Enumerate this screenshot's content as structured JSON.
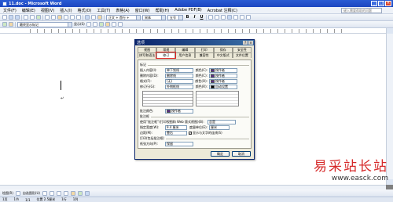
{
  "window": {
    "title": "11.doc - Microsoft Word"
  },
  "menu": {
    "items": [
      "文件(F)",
      "编辑(E)",
      "视图(V)",
      "插入(I)",
      "格式(O)",
      "工具(T)",
      "表格(A)",
      "窗口(W)",
      "帮助(H)",
      "Adobe PDF(B)",
      "Acrobat 注释(C)"
    ],
    "ask_placeholder": "键入需要帮助的问题"
  },
  "toolbar": {
    "style_value": "正文 + 首行 +",
    "font_value": "宋体",
    "size_value": "五号",
    "track_value": "最终显示标记",
    "show_label": "显示(S)"
  },
  "dialog": {
    "title": "选项",
    "tabs_row1": [
      "视图",
      "常规",
      "编辑",
      "打印",
      "保存",
      "安全性"
    ],
    "tabs_row2": [
      "拼写和语法",
      "修订",
      "用户信息",
      "兼容性",
      "中文版式",
      "文件位置"
    ],
    "group_markup": "标记",
    "rows": [
      {
        "label": "插入内容(I):",
        "value": "单下划线",
        "color_label": "颜色(C):",
        "color_value": "按作者",
        "swatch": "#5b2c8a"
      },
      {
        "label": "删除内容(D):",
        "value": "删除线",
        "color_label": "颜色(C):",
        "color_value": "按作者",
        "swatch": "#5b2c8a"
      },
      {
        "label": "格式(F):",
        "value": "(无)",
        "color_label": "颜色(O):",
        "color_value": "按作者",
        "swatch": "#5b2c8a"
      },
      {
        "label": "修订行(G):",
        "value": "外侧框线",
        "color_label": "颜色(R):",
        "color_value": "自动设置",
        "swatch": "#000000"
      }
    ],
    "comment_label": "批注颜色:",
    "comment_value": "按作者",
    "group_balloon": "批注框",
    "balloon_use_label": "使用“批注框”(打印视图和 Web 版式视图)(B):",
    "balloon_use_value": "总是",
    "width_label": "指定宽度(W):",
    "width_value": "9.4 厘米",
    "measure_label": "度量单位(E):",
    "measure_value": "厘米",
    "margin_label": "边距(M):",
    "margin_value": "靠右",
    "show_lines_label": "显示与文字的连线(S)",
    "group_print": "打印(包括批注框)",
    "paper_label": "纸张方向(P):",
    "paper_value": "保留",
    "ok_label": "确定",
    "cancel_label": "取消"
  },
  "statusbar": {
    "items": [
      "绘图(R)",
      "自选图形(U)",
      "1页",
      "1节",
      "1/1",
      "位置 2.5厘米",
      "1行",
      "1列"
    ]
  },
  "watermark": {
    "line1": "易采站长站",
    "line2": "www.easck.com"
  },
  "document": {
    "mark": "↵"
  }
}
